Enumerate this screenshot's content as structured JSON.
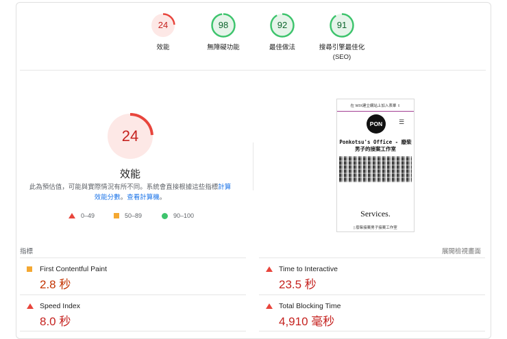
{
  "categories": [
    {
      "score": "24",
      "label": "效能",
      "sublabel": "",
      "color": "#e8453c",
      "bg": "#fde8e6",
      "fraction": 0.24
    },
    {
      "score": "98",
      "label": "無障礙功能",
      "sublabel": "",
      "color": "#3ec46d",
      "bg": "#e6f4ea",
      "fraction": 0.98
    },
    {
      "score": "92",
      "label": "最佳做法",
      "sublabel": "",
      "color": "#3ec46d",
      "bg": "#e6f4ea",
      "fraction": 0.92
    },
    {
      "score": "91",
      "label": "搜尋引擎最佳化",
      "sublabel": "(SEO)",
      "color": "#3ec46d",
      "bg": "#e6f4ea",
      "fraction": 0.91
    }
  ],
  "performance": {
    "score": "24",
    "fraction": 0.24,
    "title": "效能",
    "desc_before": "此為預估值，可能與實際情況有所不同。系統會直接根據這些指標",
    "desc_link1": "計算效能分數",
    "desc_middle": "。",
    "desc_link2": "查看計算機",
    "desc_after": "。"
  },
  "legend": {
    "fail": "0–49",
    "average": "50–89",
    "pass": "90–100"
  },
  "screenshot": {
    "banner": "在 WIX建立網站上加入表單 ⇩",
    "logo": "PON",
    "menu_icon": "☰",
    "headline": "Ponkotsu's Office - 廢柴男子的接案工作室",
    "services": "Services.",
    "footer": "| 廢柴接案男子接案工作室"
  },
  "metrics_section": {
    "title": "指標",
    "expand": "展開檢視畫面"
  },
  "metrics": [
    {
      "name": "First Contentful Paint",
      "value": "2.8 秒",
      "status": "average"
    },
    {
      "name": "Time to Interactive",
      "value": "23.5 秒",
      "status": "fail"
    },
    {
      "name": "Speed Index",
      "value": "8.0 秒",
      "status": "fail"
    },
    {
      "name": "Total Blocking Time",
      "value": "4,910 毫秒",
      "status": "fail"
    }
  ]
}
